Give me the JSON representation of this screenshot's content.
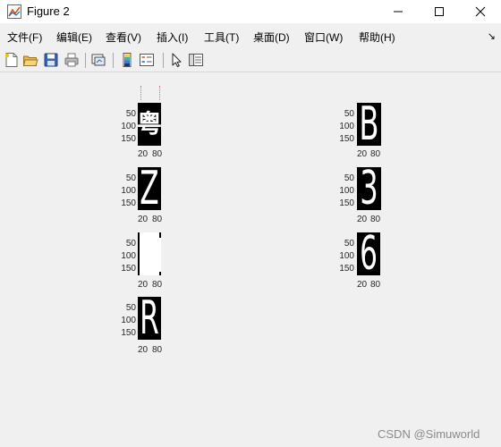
{
  "window": {
    "title": "Figure 2",
    "icon": "matlab-figure-icon"
  },
  "menu": {
    "items": [
      "文件(F)",
      "编辑(E)",
      "查看(V)",
      "插入(I)",
      "工具(T)",
      "桌面(D)",
      "窗口(W)",
      "帮助(H)"
    ],
    "overflow_glyph": "↘"
  },
  "toolbar": {
    "buttons": [
      "new-figure-icon",
      "open-file-icon",
      "save-icon",
      "print-icon",
      "link-plot-icon",
      "colorbar-icon",
      "legend-icon",
      "pointer-icon",
      "plot-browser-icon"
    ]
  },
  "subplots": [
    {
      "glyph": "粤",
      "yticks": [
        "50",
        "100",
        "150"
      ],
      "xticks": [
        "20",
        "80"
      ],
      "filled": false
    },
    {
      "glyph": "B",
      "yticks": [
        "50",
        "100",
        "150"
      ],
      "xticks": [
        "20",
        "80"
      ],
      "filled": false
    },
    {
      "glyph": "Z",
      "yticks": [
        "50",
        "100",
        "150"
      ],
      "xticks": [
        "20",
        "80"
      ],
      "filled": false
    },
    {
      "glyph": "3",
      "yticks": [
        "50",
        "100",
        "150"
      ],
      "xticks": [
        "20",
        "80"
      ],
      "filled": false
    },
    {
      "glyph": "",
      "yticks": [
        "50",
        "100",
        "150"
      ],
      "xticks": [
        "20",
        "80"
      ],
      "filled": true
    },
    {
      "glyph": "6",
      "yticks": [
        "50",
        "100",
        "150"
      ],
      "xticks": [
        "20",
        "80"
      ],
      "filled": false
    },
    {
      "glyph": "R",
      "yticks": [
        "50",
        "100",
        "150"
      ],
      "xticks": [
        "20",
        "80"
      ],
      "filled": false
    }
  ],
  "watermark": "CSDN @Simuworld"
}
